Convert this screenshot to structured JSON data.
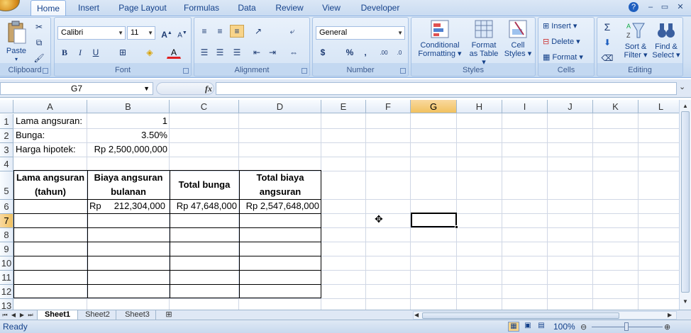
{
  "tabs": [
    "Home",
    "Insert",
    "Page Layout",
    "Formulas",
    "Data",
    "Review",
    "View",
    "Developer"
  ],
  "active_tab": "Home",
  "ribbon": {
    "clipboard": {
      "label": "Clipboard",
      "paste": "Paste"
    },
    "font": {
      "label": "Font",
      "name": "Calibri",
      "size": "11"
    },
    "alignment": {
      "label": "Alignment"
    },
    "number": {
      "label": "Number",
      "format": "General"
    },
    "styles": {
      "label": "Styles",
      "conditional": "Conditional",
      "formatting": "Formatting",
      "format_as": "Format",
      "as_table": "as Table",
      "cell": "Cell",
      "cell_styles": "Styles"
    },
    "cells": {
      "label": "Cells",
      "insert": "Insert",
      "delete": "Delete",
      "format": "Format"
    },
    "editing": {
      "label": "Editing",
      "sort": "Sort &",
      "filter": "Filter",
      "find": "Find &",
      "select": "Select"
    }
  },
  "namebox": "G7",
  "formula": "",
  "columns": [
    "A",
    "B",
    "C",
    "D",
    "E",
    "F",
    "G",
    "H",
    "I",
    "J",
    "K",
    "L"
  ],
  "rows": [
    "1",
    "2",
    "3",
    "4",
    "5",
    "6",
    "7",
    "8",
    "9",
    "10",
    "11",
    "12",
    "13"
  ],
  "cells": {
    "A1": "Lama angsuran:",
    "B1": "1",
    "A2": "Bunga:",
    "B2": "3.50%",
    "A3": "Harga hipotek:",
    "B3": "Rp 2,500,000,000",
    "A5a": "Lama angsuran",
    "A5b": "(tahun)",
    "B5a": "Biaya angsuran",
    "B5b": "bulanan",
    "C5": "Total bunga",
    "D5a": "Total biaya",
    "D5b": "angsuran",
    "B6cur": "Rp",
    "B6val": "212,304,000",
    "C6": "Rp 47,648,000",
    "D6": "Rp 2,547,648,000"
  },
  "sheets": [
    "Sheet1",
    "Sheet2",
    "Sheet3"
  ],
  "active_sheet": "Sheet1",
  "status": {
    "ready": "Ready",
    "zoom": "100%"
  }
}
